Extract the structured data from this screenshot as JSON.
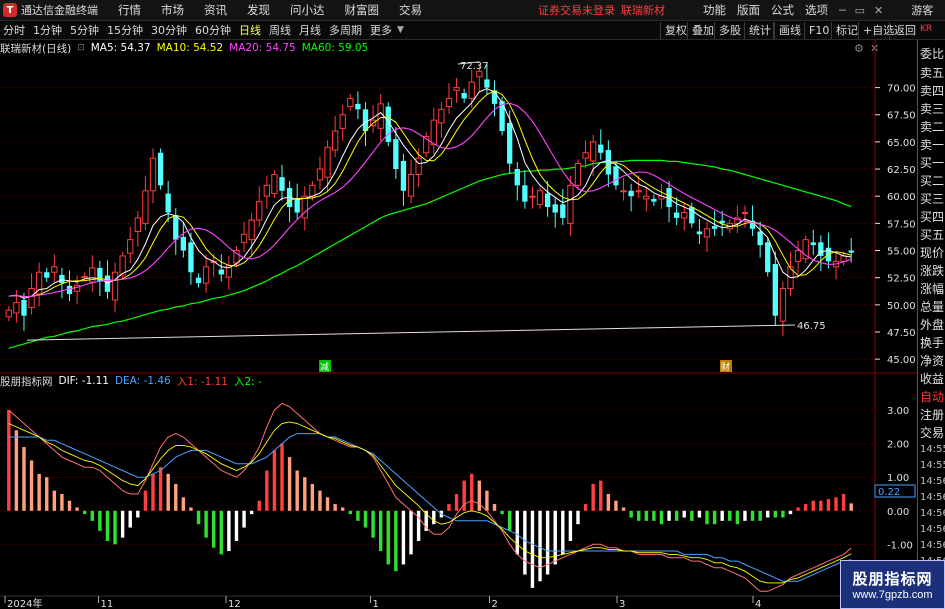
{
  "menu": {
    "app_title": "通达信金融终端",
    "items": [
      "行情",
      "市场",
      "资讯",
      "发现",
      "问小达",
      "财富圈",
      "交易"
    ],
    "status": "证券交易未登录",
    "stock": "联瑞新材",
    "right_items": [
      "功能",
      "版面",
      "公式",
      "选项"
    ],
    "guest": "游客"
  },
  "periods": [
    "分时",
    "1分钟",
    "5分钟",
    "15分钟",
    "30分钟",
    "60分钟",
    "日线",
    "周线",
    "月线",
    "多周期",
    "更多"
  ],
  "active_period": "日线",
  "toolbar_right": [
    "复权",
    "叠加",
    "多股",
    "统计",
    "画线",
    "F10",
    "标记",
    "+自选",
    "返回"
  ],
  "main_indicator": {
    "name": "联瑞新材(日线)",
    "ma5": "MA5: 54.37",
    "ma10": "MA10: 54.52",
    "ma20": "MA20: 54.75",
    "ma60": "MA60: 59.05",
    "high_label": "72.37",
    "low_label": "46.75",
    "event_marks": [
      "减",
      "财"
    ]
  },
  "macd_indicator": {
    "name": "股朋指标网",
    "dif": "DIF: -1.11",
    "dea": "DEA: -1.46",
    "l1": "入1: -1.11",
    "l2": "入2: -",
    "current_box": "0.22"
  },
  "price_axis": [
    "70.00",
    "67.50",
    "65.00",
    "62.50",
    "60.00",
    "57.50",
    "55.00",
    "52.50",
    "50.00",
    "47.50",
    "45.00"
  ],
  "macd_axis": [
    "3.00",
    "2.00",
    "1.00",
    "0.00",
    "-1.00"
  ],
  "date_axis": [
    "2024年",
    "11",
    "12",
    "1",
    "2",
    "3",
    "4"
  ],
  "side_panel": {
    "top": "KR",
    "labels": [
      "委比",
      "卖五",
      "卖四",
      "卖三",
      "卖二",
      "卖一",
      "买一",
      "买二",
      "买三",
      "买四",
      "买五",
      "现价",
      "涨跌",
      "涨幅",
      "总量",
      "外盘",
      "换手",
      "净资",
      "收益",
      "自动",
      "注册",
      "交易"
    ],
    "times": [
      "14:55",
      "14:55",
      "14:56",
      "14:56",
      "14:56",
      "14:56",
      "14:56",
      "14:56"
    ]
  },
  "watermark": {
    "title": "股朋指标网",
    "url": "www.7gpzb.com"
  },
  "colors": {
    "up": "#ff3c3c",
    "down": "#54ffff",
    "ma5": "#ffffff",
    "ma10": "#ffff00",
    "ma20": "#ff44ff",
    "ma60": "#00ff00",
    "dif": "#ffffff",
    "dea": "#ffff00",
    "grid": "#8b0000"
  },
  "chart_data": [
    {
      "type": "candlestick",
      "title": "联瑞新材(日线)",
      "ylim": [
        44,
        73
      ],
      "x_labels": [
        "2024年",
        "11",
        "12",
        "1",
        "2",
        "3",
        "4"
      ],
      "high": 72.37,
      "low": 46.75,
      "close_series": [
        49.5,
        50.2,
        49.0,
        51.5,
        53.0,
        52.5,
        53.5,
        52.0,
        51.0,
        51.8,
        52.6,
        53.4,
        52.2,
        51.2,
        53.0,
        54.5,
        56.0,
        58.0,
        60.5,
        63.5,
        61.0,
        58.5,
        56.0,
        55.0,
        53.0,
        52.0,
        53.5,
        54.0,
        52.8,
        53.6,
        55.0,
        56.5,
        57.8,
        59.5,
        61.0,
        62.0,
        60.5,
        59.0,
        58.5,
        60.0,
        61.0,
        62.5,
        64.5,
        66.0,
        67.5,
        69.0,
        68.0,
        66.0,
        67.0,
        68.5,
        65.0,
        62.5,
        60.5,
        62.0,
        63.5,
        65.5,
        67.0,
        68.0,
        69.0,
        70.0,
        69.0,
        70.5,
        71.5,
        70.0,
        68.5,
        66.0,
        63.0,
        61.0,
        59.5,
        60.0,
        60.5,
        59.0,
        58.5,
        58.0,
        61.0,
        63.0,
        64.0,
        65.0,
        64.0,
        62.0,
        61.0,
        60.5,
        60.0,
        60.5,
        60.0,
        59.5,
        60.0,
        59.0,
        58.0,
        58.5,
        57.5,
        56.5,
        57.0,
        57.0,
        57.5,
        57.5,
        58.0,
        58.5,
        57.0,
        55.5,
        53.0,
        49.0,
        51.5,
        53.5,
        55.0,
        56.0,
        55.5,
        54.5,
        54.0,
        54.0,
        54.5,
        54.8
      ],
      "ma5": [
        50.8,
        50.9,
        50.6,
        50.8,
        51.4,
        51.5,
        52.0,
        52.3,
        52.2,
        52.1,
        52.4,
        52.5,
        52.4,
        52.0,
        52.3,
        52.9,
        53.2,
        54.2,
        55.6,
        57.3,
        58.1,
        58.4,
        58.2,
        57.6,
        56.2,
        55.0,
        54.3,
        54.0,
        53.5,
        53.4,
        53.8,
        54.4,
        55.4,
        56.5,
        57.9,
        59.2,
        59.8,
        59.9,
        59.7,
        59.8,
        60.0,
        60.3,
        61.0,
        62.2,
        63.7,
        65.1,
        66.2,
        66.8,
        67.2,
        67.7,
        66.9,
        65.8,
        64.7,
        63.8,
        63.0,
        63.1,
        63.7,
        64.8,
        66.1,
        67.2,
        67.9,
        68.6,
        69.6,
        69.9,
        69.6,
        68.6,
        67.1,
        65.3,
        63.1,
        61.9,
        61.0,
        60.4,
        59.9,
        59.4,
        59.7,
        60.1,
        61.0,
        62.5,
        63.1,
        63.3,
        62.9,
        62.3,
        61.6,
        61.1,
        60.8,
        60.3,
        60.0,
        59.8,
        59.3,
        59.0,
        58.7,
        58.2,
        57.8,
        57.4,
        57.1,
        57.2,
        57.4,
        57.9,
        57.6,
        56.9,
        56.2,
        54.5,
        53.0,
        52.5,
        52.6,
        53.2,
        54.1,
        54.9,
        55.0,
        54.8,
        54.5,
        54.4
      ],
      "ma60": [
        46.0,
        46.2,
        46.4,
        46.6,
        46.8,
        47.0,
        47.1,
        47.3,
        47.5,
        47.6,
        47.8,
        48.0,
        48.1,
        48.2,
        48.4,
        48.5,
        48.7,
        48.9,
        49.1,
        49.3,
        49.5,
        49.6,
        49.8,
        49.9,
        50.1,
        50.2,
        50.4,
        50.6,
        50.7,
        50.9,
        51.1,
        51.3,
        51.6,
        51.9,
        52.2,
        52.6,
        52.9,
        53.3,
        53.6,
        54.0,
        54.4,
        54.8,
        55.2,
        55.6,
        56.0,
        56.4,
        56.8,
        57.2,
        57.6,
        58.0,
        58.3,
        58.5,
        58.7,
        58.9,
        59.1,
        59.3,
        59.6,
        59.9,
        60.2,
        60.5,
        60.8,
        61.1,
        61.4,
        61.6,
        61.8,
        62.0,
        62.1,
        62.2,
        62.3,
        62.3,
        62.4,
        62.4,
        62.5,
        62.5,
        62.6,
        62.7,
        62.8,
        63.0,
        63.1,
        63.1,
        63.2,
        63.2,
        63.3,
        63.3,
        63.3,
        63.3,
        63.3,
        63.2,
        63.2,
        63.1,
        63.0,
        62.9,
        62.8,
        62.7,
        62.5,
        62.4,
        62.2,
        62.0,
        61.8,
        61.6,
        61.4,
        61.2,
        61.0,
        60.8,
        60.6,
        60.4,
        60.2,
        60.0,
        59.8,
        59.6,
        59.3,
        59.05
      ]
    },
    {
      "type": "bar",
      "title": "股朋指标网",
      "ylim": [
        -2.6,
        3.6
      ],
      "hist": [
        3.0,
        2.4,
        1.9,
        1.5,
        1.1,
        1.0,
        0.6,
        0.5,
        0.3,
        0.1,
        -0.1,
        -0.3,
        -0.6,
        -0.9,
        -1.0,
        -0.8,
        -0.5,
        -0.2,
        0.6,
        1.1,
        1.3,
        1.1,
        0.8,
        0.4,
        0.1,
        -0.4,
        -0.8,
        -1.1,
        -1.3,
        -1.2,
        -0.9,
        -0.5,
        -0.1,
        0.3,
        1.2,
        1.8,
        2.0,
        1.6,
        1.2,
        1.0,
        0.8,
        0.6,
        0.4,
        0.2,
        0.1,
        -0.1,
        -0.3,
        -0.5,
        -0.8,
        -1.2,
        -1.6,
        -1.8,
        -1.6,
        -1.3,
        -0.9,
        -0.6,
        -0.4,
        -0.2,
        0.2,
        0.5,
        0.9,
        1.1,
        0.9,
        0.6,
        0.2,
        -0.1,
        -0.6,
        -1.3,
        -1.9,
        -2.3,
        -2.1,
        -1.9,
        -1.6,
        -1.3,
        -0.9,
        -0.4,
        0.2,
        0.8,
        0.9,
        0.5,
        0.3,
        0.1,
        -0.2,
        -0.3,
        -0.3,
        -0.3,
        -0.4,
        -0.3,
        -0.3,
        -0.2,
        -0.3,
        -0.2,
        -0.4,
        -0.4,
        -0.3,
        -0.3,
        -0.4,
        -0.3,
        -0.3,
        -0.3,
        -0.2,
        -0.2,
        -0.2,
        -0.1,
        0.1,
        0.2,
        0.3,
        0.3,
        0.35,
        0.4,
        0.5,
        0.22
      ],
      "dif": [
        3.0,
        2.8,
        2.6,
        2.4,
        2.2,
        2.0,
        1.8,
        1.6,
        1.5,
        1.4,
        1.3,
        1.3,
        1.2,
        1.0,
        0.8,
        0.6,
        0.5,
        0.5,
        0.9,
        1.4,
        1.9,
        2.2,
        2.3,
        2.2,
        2.0,
        1.8,
        1.6,
        1.4,
        1.2,
        1.1,
        1.0,
        1.2,
        1.5,
        1.9,
        2.5,
        3.0,
        3.2,
        3.1,
        2.9,
        2.7,
        2.5,
        2.3,
        2.2,
        2.1,
        2.0,
        1.9,
        1.9,
        1.8,
        1.6,
        1.2,
        0.8,
        0.4,
        0.2,
        0.0,
        -0.2,
        -0.5,
        -0.7,
        -0.7,
        -0.5,
        -0.1,
        0.2,
        0.3,
        0.2,
        0.0,
        -0.3,
        -0.6,
        -1.0,
        -1.3,
        -1.5,
        -1.6,
        -1.7,
        -1.6,
        -1.5,
        -1.4,
        -1.3,
        -1.2,
        -1.1,
        -1.0,
        -1.0,
        -1.1,
        -1.1,
        -1.2,
        -1.2,
        -1.3,
        -1.3,
        -1.3,
        -1.3,
        -1.4,
        -1.4,
        -1.4,
        -1.5,
        -1.5,
        -1.6,
        -1.7,
        -1.7,
        -1.8,
        -1.9,
        -2.0,
        -2.2,
        -2.4,
        -2.4,
        -2.3,
        -2.2,
        -2.0,
        -1.9,
        -1.8,
        -1.7,
        -1.6,
        -1.5,
        -1.4,
        -1.3,
        -1.11
      ],
      "dea": [
        2.2,
        2.2,
        2.2,
        2.2,
        2.2,
        2.1,
        2.1,
        2.0,
        1.9,
        1.8,
        1.7,
        1.6,
        1.5,
        1.4,
        1.3,
        1.2,
        1.1,
        1.0,
        1.0,
        1.1,
        1.2,
        1.4,
        1.6,
        1.7,
        1.8,
        1.8,
        1.8,
        1.7,
        1.6,
        1.5,
        1.4,
        1.4,
        1.4,
        1.5,
        1.6,
        1.8,
        2.0,
        2.2,
        2.3,
        2.3,
        2.3,
        2.3,
        2.2,
        2.2,
        2.1,
        2.0,
        1.9,
        1.8,
        1.7,
        1.5,
        1.3,
        1.1,
        0.9,
        0.7,
        0.5,
        0.3,
        0.1,
        -0.1,
        -0.2,
        -0.3,
        -0.3,
        -0.3,
        -0.3,
        -0.3,
        -0.4,
        -0.5,
        -0.6,
        -0.7,
        -0.9,
        -1.0,
        -1.1,
        -1.2,
        -1.2,
        -1.2,
        -1.2,
        -1.2,
        -1.2,
        -1.2,
        -1.2,
        -1.2,
        -1.2,
        -1.2,
        -1.2,
        -1.2,
        -1.2,
        -1.2,
        -1.2,
        -1.2,
        -1.2,
        -1.3,
        -1.3,
        -1.3,
        -1.3,
        -1.4,
        -1.4,
        -1.5,
        -1.5,
        -1.6,
        -1.7,
        -1.8,
        -1.9,
        -2.0,
        -2.1,
        -2.1,
        -2.1,
        -2.0,
        -1.9,
        -1.8,
        -1.7,
        -1.6,
        -1.5,
        -1.46
      ]
    }
  ]
}
